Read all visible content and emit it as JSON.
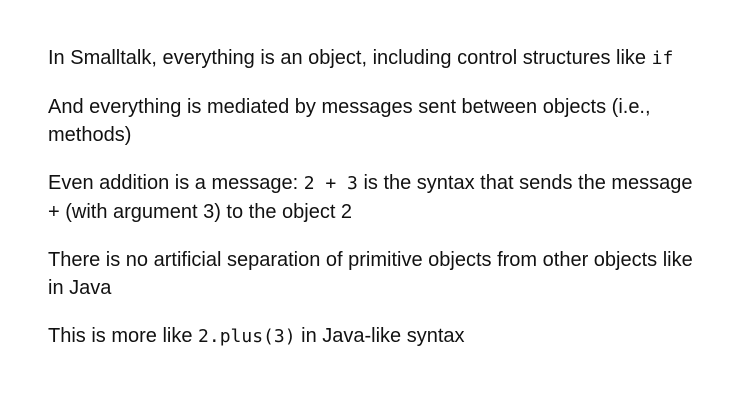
{
  "paragraphs": [
    {
      "t1": "In Smalltalk, everything is an object, including control structures like ",
      "c1": "if"
    },
    {
      "t1": "And everything is mediated by messages sent between objects (i.e., methods)"
    },
    {
      "t1": "Even addition is a message: ",
      "c1": "2 + 3",
      "t2": " is the syntax that sends the message + (with argument 3) to the object 2"
    },
    {
      "t1": "There is no artificial separation of primitive objects from other objects like in Java"
    },
    {
      "t1": "This is more like ",
      "c1": "2.plus(3)",
      "t2": " in Java-like syntax"
    }
  ]
}
